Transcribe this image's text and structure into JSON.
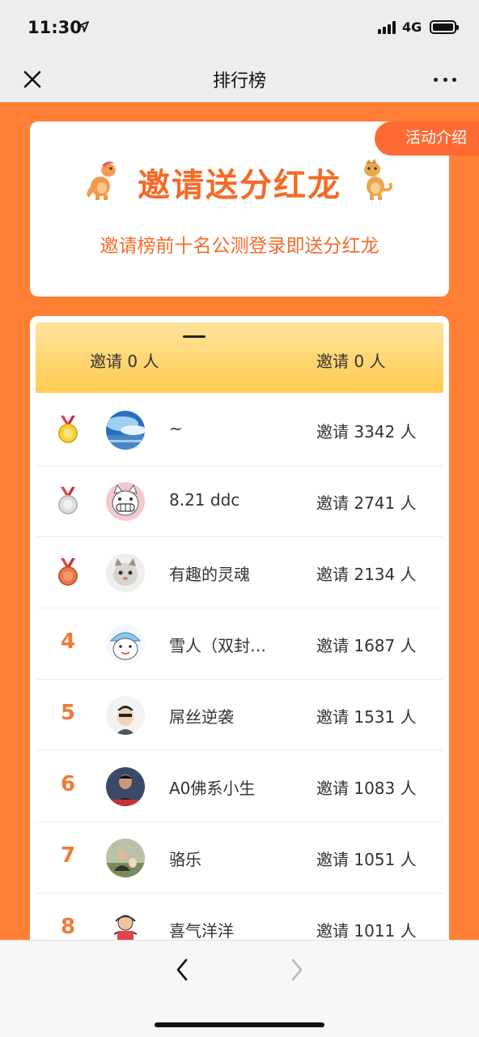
{
  "status": {
    "time": "11:30",
    "network": "4G"
  },
  "nav": {
    "title": "排行榜"
  },
  "banner": {
    "activity_label": "活动介绍",
    "title": "邀请送分红龙",
    "subtitle": "邀请榜前十名公测登录即送分红龙"
  },
  "my_stats": {
    "left": "邀请 0 人",
    "right": "邀请 0 人"
  },
  "rankings": [
    {
      "rank": "1",
      "name": "~",
      "invite": "邀请 3342 人"
    },
    {
      "rank": "2",
      "name": "8.21 ddc",
      "invite": "邀请 2741 人"
    },
    {
      "rank": "3",
      "name": "有趣的灵魂",
      "invite": "邀请 2134 人"
    },
    {
      "rank": "4",
      "name": "雪人（双封…",
      "invite": "邀请 1687 人"
    },
    {
      "rank": "5",
      "name": "屌丝逆袭",
      "invite": "邀请 1531 人"
    },
    {
      "rank": "6",
      "name": "A0佛系小生",
      "invite": "邀请 1083 人"
    },
    {
      "rank": "7",
      "name": "骆乐",
      "invite": "邀请 1051 人"
    },
    {
      "rank": "8",
      "name": "喜气洋洋",
      "invite": "邀请 1011 人"
    }
  ],
  "icons": {
    "close": "close-icon",
    "more": "more-dots-icon",
    "back": "chevron-left-icon",
    "forward": "chevron-right-icon",
    "gold": "gold-medal-icon",
    "silver": "silver-medal-icon",
    "bronze": "bronze-medal-icon"
  },
  "colors": {
    "accent": "#ff7f35",
    "title": "#f56a27",
    "rank": "#f07a37",
    "bar": "#ffcb50"
  }
}
